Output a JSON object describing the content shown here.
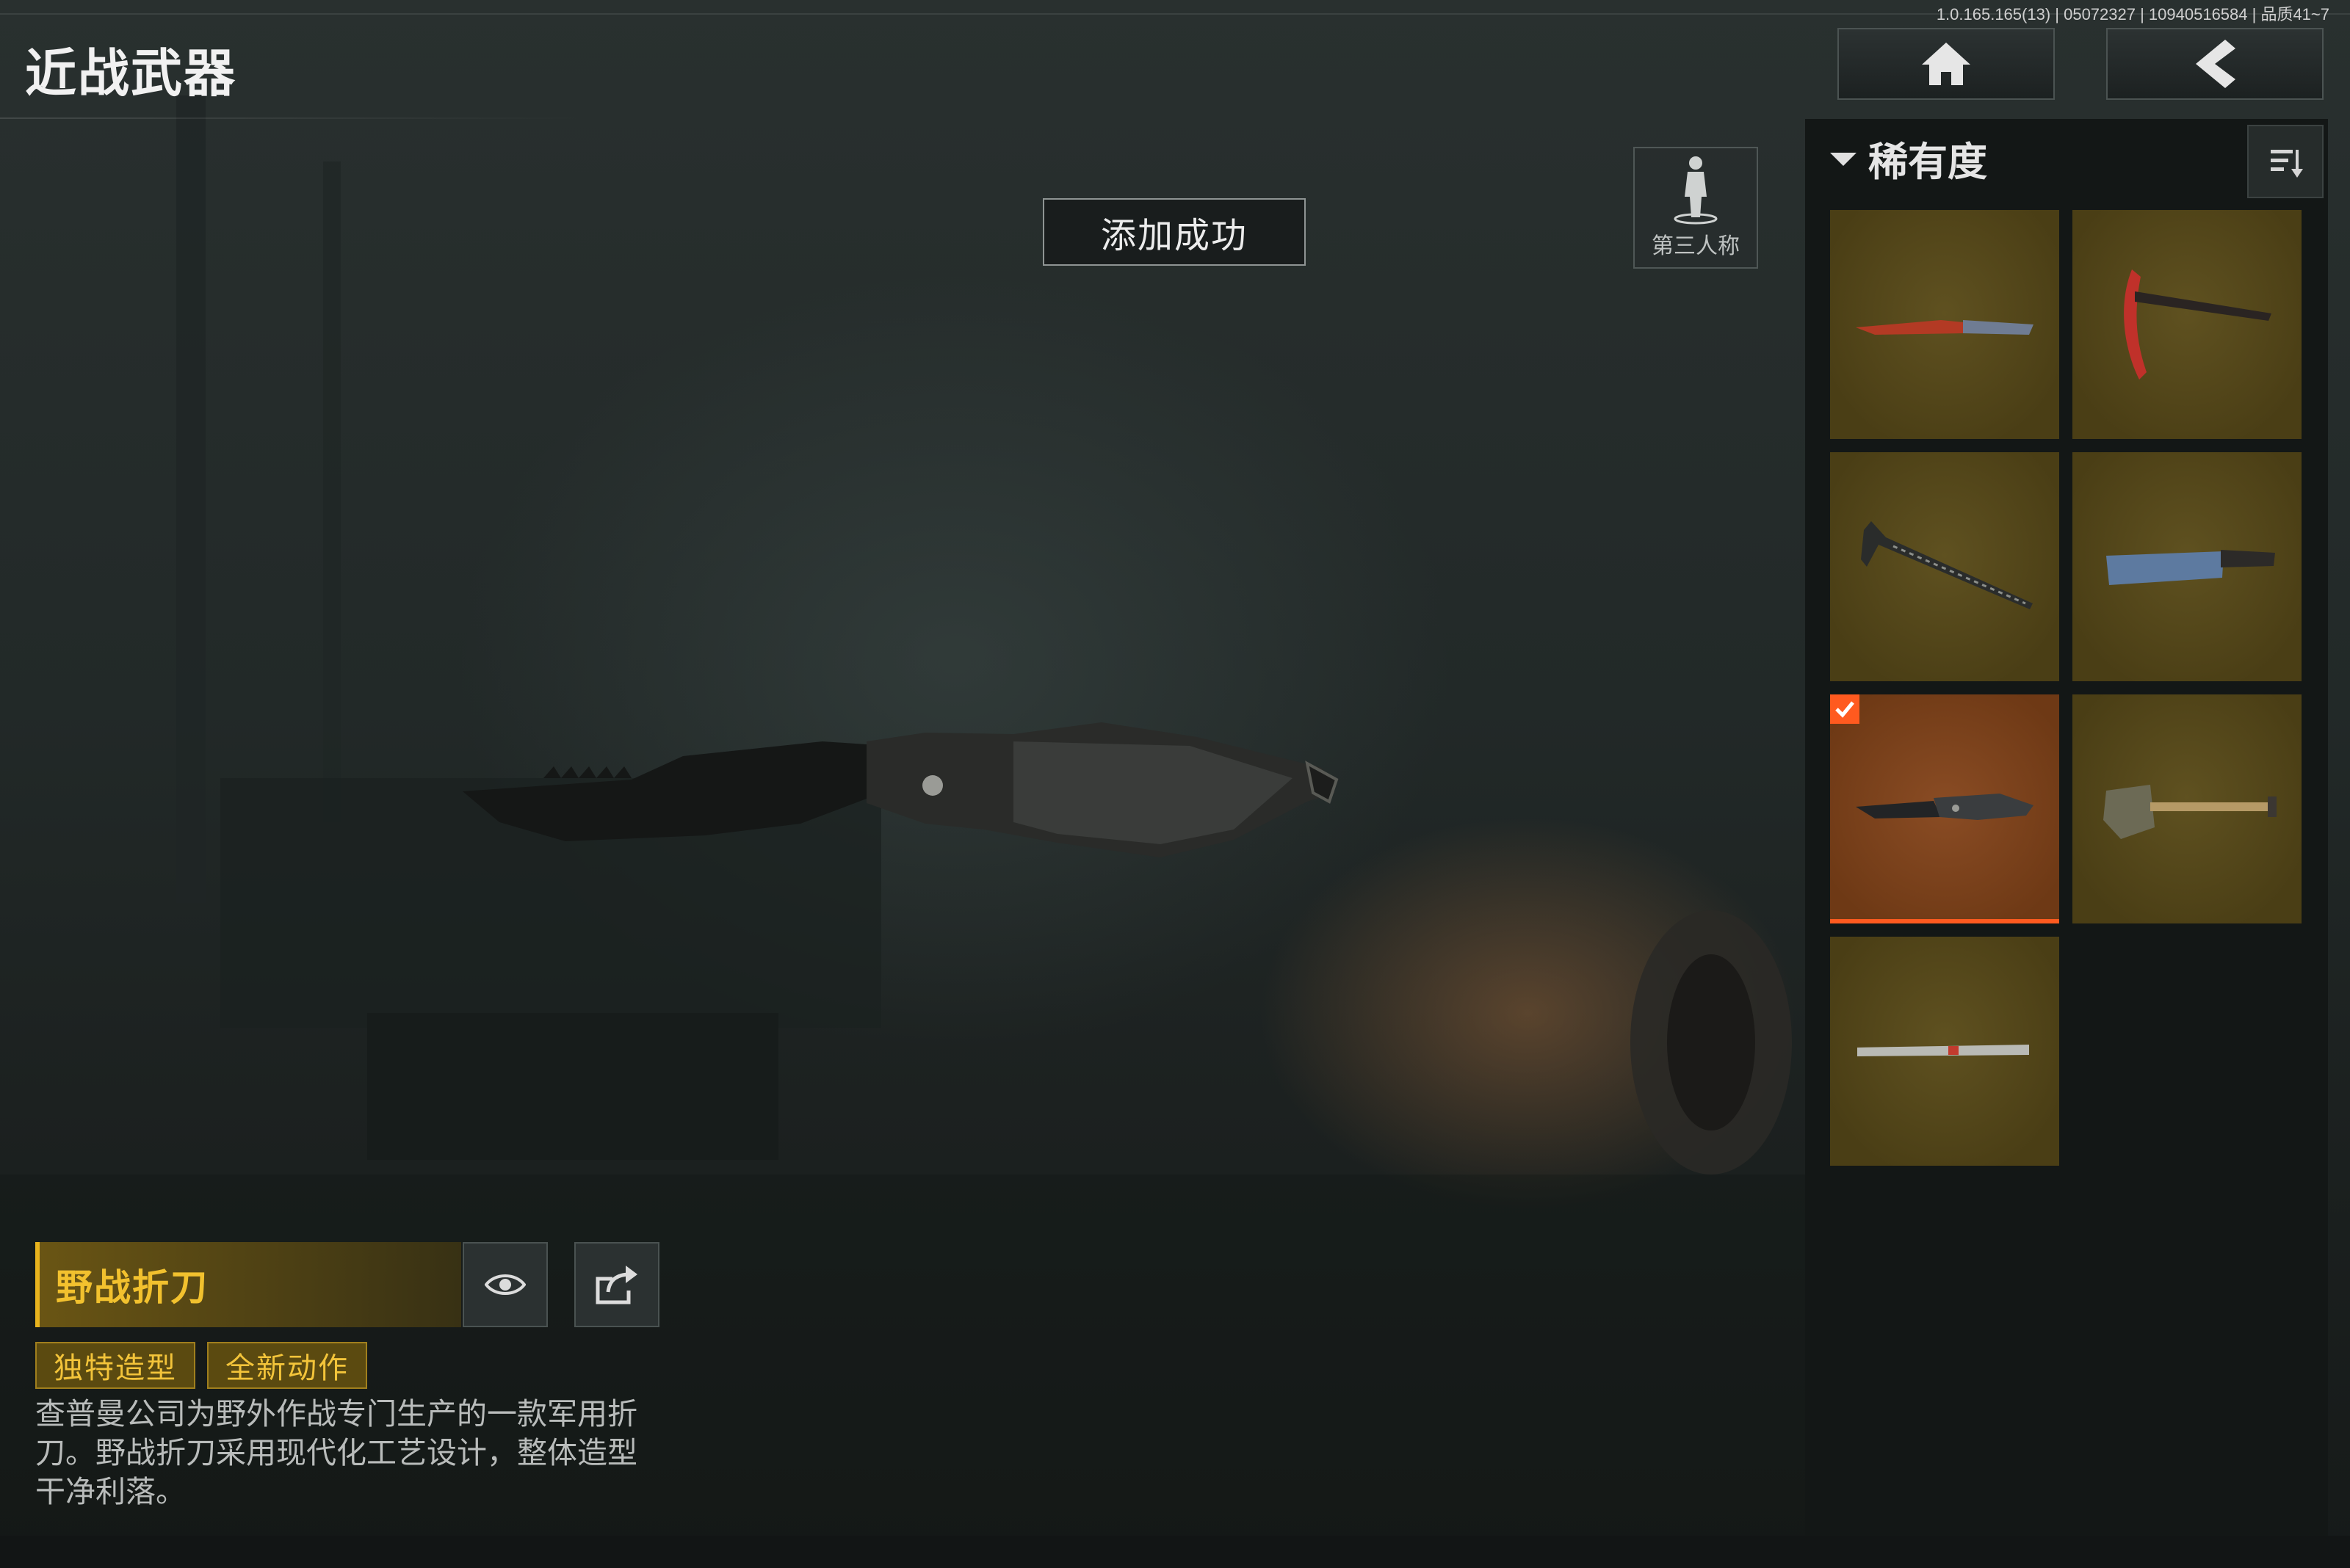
{
  "header": {
    "title": "近战武器",
    "version": "1.0.165.165(13) | 05072327 | 10940516584 | 品质41~7"
  },
  "nav": {
    "home_icon": "home-icon",
    "back_icon": "chevron-left-icon"
  },
  "toast": {
    "text": "添加成功"
  },
  "view_toggle": {
    "label": "第三人称",
    "icon": "person-icon"
  },
  "panel": {
    "filter_label": "稀有度",
    "sort_icon": "sort-icon",
    "items": [
      {
        "name": "red-blade-knife",
        "selected": false
      },
      {
        "name": "red-pickaxe",
        "selected": false
      },
      {
        "name": "serrated-spear",
        "selected": false
      },
      {
        "name": "blue-machete",
        "selected": false
      },
      {
        "name": "field-folding-knife",
        "selected": true
      },
      {
        "name": "shovel",
        "selected": false
      },
      {
        "name": "red-rod-blade",
        "selected": false
      }
    ]
  },
  "weapon": {
    "name": "野战折刀",
    "tags": [
      "独特造型",
      "全新动作"
    ],
    "description": "查普曼公司为野外作战专门生产的一款军用折刀。野战折刀采用现代化工艺设计，整体造型干净利落。"
  },
  "colors": {
    "accent_gold": "#e8b31d",
    "selected_orange": "#ff5a1f",
    "tile_gold": "#5f5120"
  }
}
